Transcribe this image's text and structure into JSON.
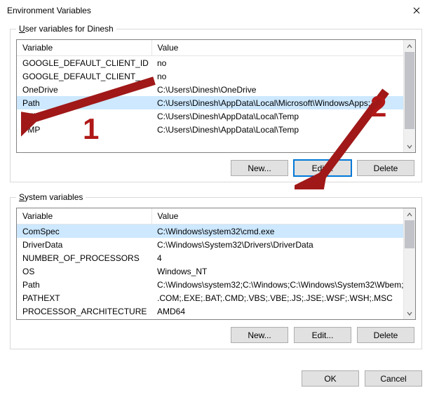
{
  "window": {
    "title": "Environment Variables",
    "close_tooltip": "Close"
  },
  "user_section": {
    "legend_prefix": "U",
    "legend_rest": "ser variables for Dinesh",
    "col_variable": "Variable",
    "col_value": "Value",
    "rows": [
      {
        "variable": "GOOGLE_DEFAULT_CLIENT_ID",
        "value": "no"
      },
      {
        "variable": "GOOGLE_DEFAULT_CLIENT_",
        "value": "no"
      },
      {
        "variable": "OneDrive",
        "value": "C:\\Users\\Dinesh\\OneDrive"
      },
      {
        "variable": "Path",
        "value": "C:\\Users\\Dinesh\\AppData\\Local\\Microsoft\\WindowsApps;"
      },
      {
        "variable": "TEMP",
        "value": "C:\\Users\\Dinesh\\AppData\\Local\\Temp"
      },
      {
        "variable": "TMP",
        "value": "C:\\Users\\Dinesh\\AppData\\Local\\Temp"
      }
    ],
    "selected_index": 3,
    "btn_new": "New...",
    "btn_edit": "Edit...",
    "btn_delete": "Delete"
  },
  "system_section": {
    "legend_prefix": "S",
    "legend_rest": "ystem variables",
    "col_variable": "Variable",
    "col_value": "Value",
    "rows": [
      {
        "variable": "ComSpec",
        "value": "C:\\Windows\\system32\\cmd.exe"
      },
      {
        "variable": "DriverData",
        "value": "C:\\Windows\\System32\\Drivers\\DriverData"
      },
      {
        "variable": "NUMBER_OF_PROCESSORS",
        "value": "4"
      },
      {
        "variable": "OS",
        "value": "Windows_NT"
      },
      {
        "variable": "Path",
        "value": "C:\\Windows\\system32;C:\\Windows;C:\\Windows\\System32\\Wbem;..."
      },
      {
        "variable": "PATHEXT",
        "value": ".COM;.EXE;.BAT;.CMD;.VBS;.VBE;.JS;.JSE;.WSF;.WSH;.MSC"
      },
      {
        "variable": "PROCESSOR_ARCHITECTURE",
        "value": "AMD64"
      }
    ],
    "selected_index": 0,
    "btn_new": "New...",
    "btn_edit": "Edit...",
    "btn_delete": "Delete"
  },
  "dialog_buttons": {
    "ok": "OK",
    "cancel": "Cancel"
  },
  "annotations": {
    "num1": "1",
    "num2": "2"
  }
}
